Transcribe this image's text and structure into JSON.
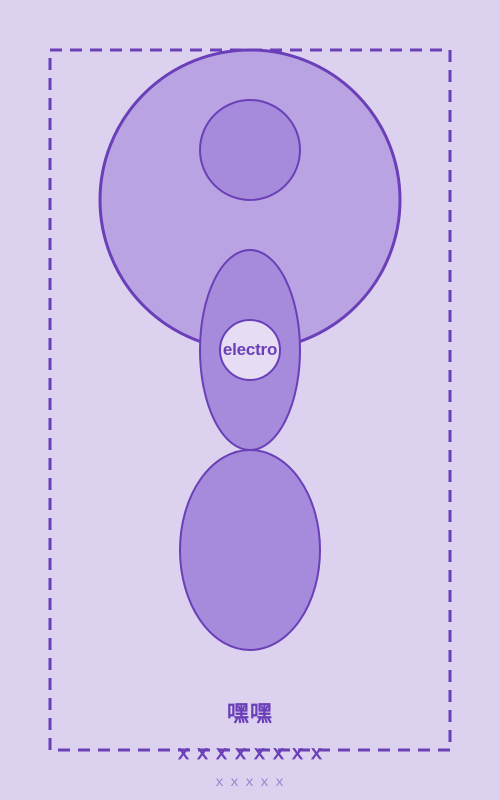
{
  "labels": {
    "center": "electro",
    "title": "嘿嘿",
    "subtitle": "ｘｘｘｘｘｘｘｘ",
    "caption": "ｘｘｘｘｘ"
  },
  "colors": {
    "background": "#dcd2ef",
    "outline": "#6a3fb8",
    "large_fill": "#b9a3e3",
    "medium_fill": "#a68adb",
    "center_fill": "#e6ddf4"
  }
}
